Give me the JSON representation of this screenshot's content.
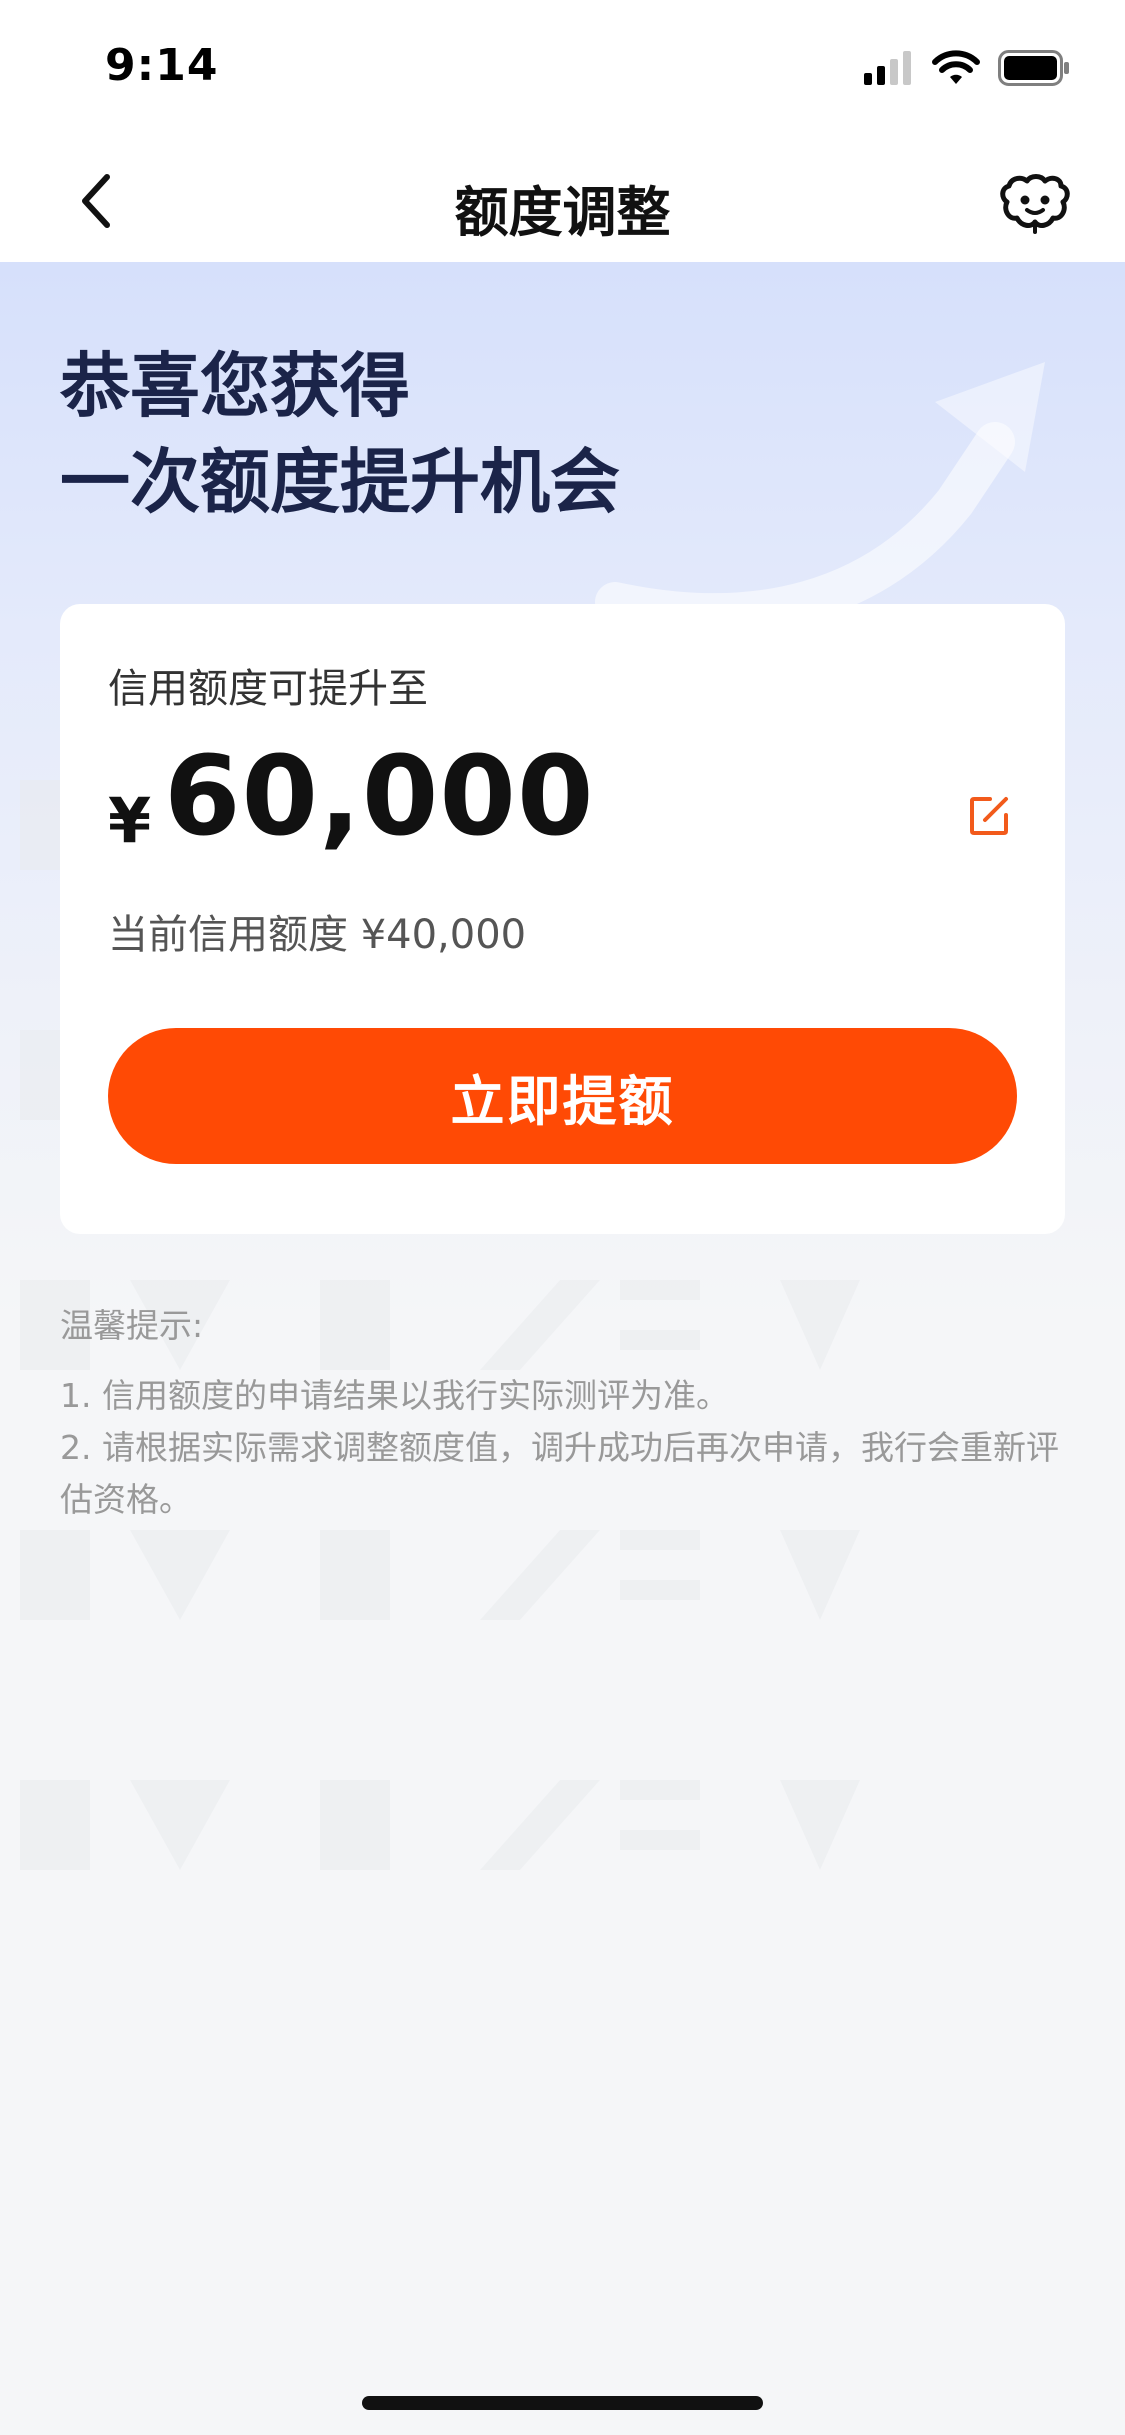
{
  "status_bar": {
    "time": "9:14"
  },
  "nav": {
    "title": "额度调整"
  },
  "hero": {
    "line1": "恭喜您获得",
    "line2": "一次额度提升机会"
  },
  "card": {
    "label": "信用额度可提升至",
    "currency": "¥",
    "amount": "60,000",
    "current": "当前信用额度 ¥40,000",
    "button": "立即提额"
  },
  "tips": {
    "title": "温馨提示:",
    "items": [
      "1. 信用额度的申请结果以我行实际测评为准。",
      "2. 请根据实际需求调整额度值，调升成功后再次申请，我行会重新评估资格。"
    ]
  },
  "colors": {
    "accent": "#ff4a05",
    "hero_text": "#1b2449"
  }
}
